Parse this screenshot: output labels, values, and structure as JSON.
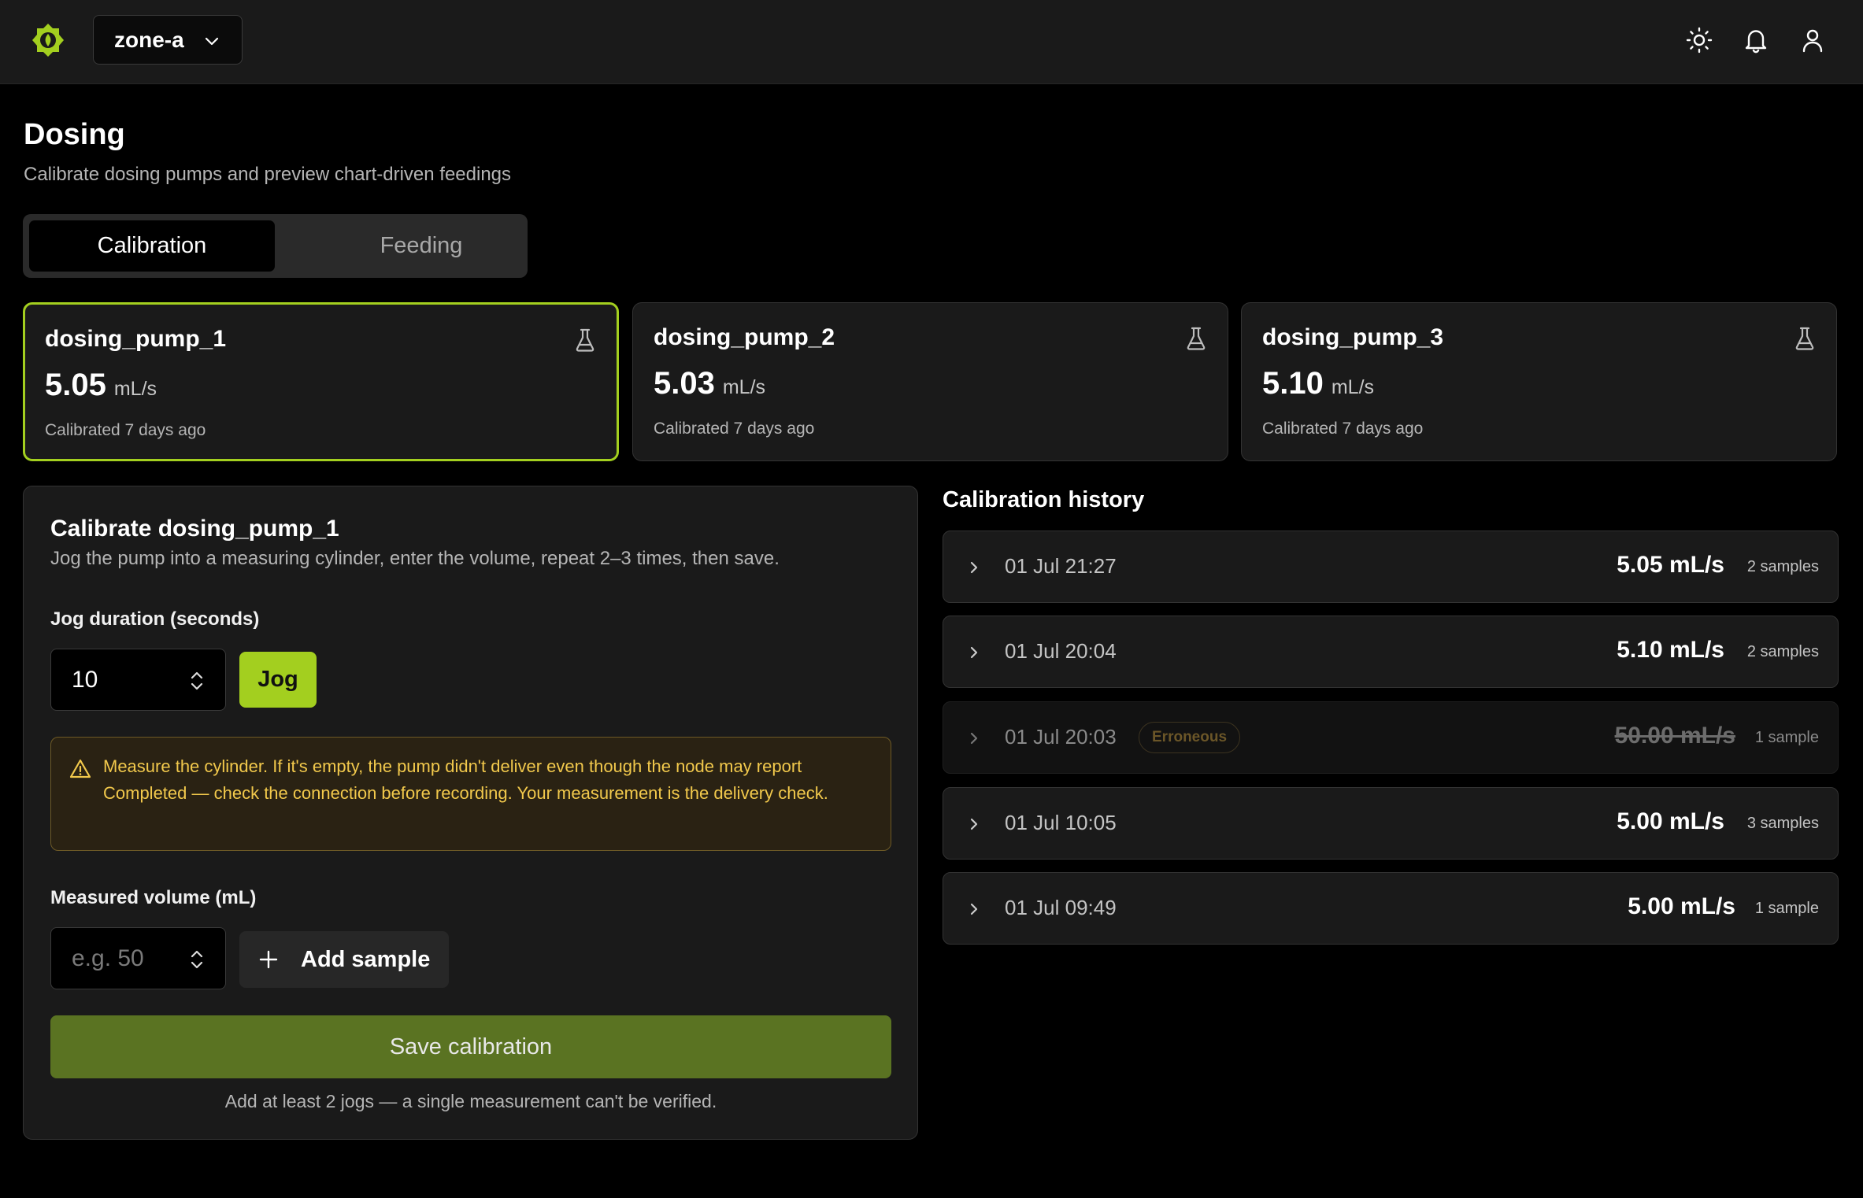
{
  "header": {
    "zone": "zone-a",
    "icons": [
      "sun-icon",
      "bell-icon",
      "user-icon"
    ]
  },
  "page": {
    "title": "Dosing",
    "subtitle": "Calibrate dosing pumps and preview chart-driven feedings"
  },
  "tabs": [
    {
      "label": "Calibration",
      "active": true
    },
    {
      "label": "Feeding",
      "active": false
    }
  ],
  "pumps": [
    {
      "name": "dosing_pump_1",
      "rate": "5.05",
      "unit": "mL/s",
      "calibrated": "Calibrated 7 days ago",
      "selected": true
    },
    {
      "name": "dosing_pump_2",
      "rate": "5.03",
      "unit": "mL/s",
      "calibrated": "Calibrated 7 days ago",
      "selected": false
    },
    {
      "name": "dosing_pump_3",
      "rate": "5.10",
      "unit": "mL/s",
      "calibrated": "Calibrated 7 days ago",
      "selected": false
    }
  ],
  "calibrate": {
    "title": "Calibrate dosing_pump_1",
    "description": "Jog the pump into a measuring cylinder, enter the volume, repeat 2–3 times, then save.",
    "jog_label": "Jog duration (seconds)",
    "jog_value": "10",
    "jog_button": "Jog",
    "warning": "Measure the cylinder. If it's empty, the pump didn't deliver even though the node may report Completed — check the connection before recording. Your measurement is the delivery check.",
    "volume_label": "Measured volume (mL)",
    "volume_placeholder": "e.g. 50",
    "add_sample": "Add sample",
    "save_button": "Save calibration",
    "save_note": "Add at least 2 jogs — a single measurement can't be verified."
  },
  "history": {
    "title": "Calibration history",
    "rows": [
      {
        "date": "01 Jul 21:27",
        "rate": "5.05 mL/s",
        "samples": "2 samples",
        "badge": "",
        "erroneous": false
      },
      {
        "date": "01 Jul 20:04",
        "rate": "5.10 mL/s",
        "samples": "2 samples",
        "badge": "",
        "erroneous": false
      },
      {
        "date": "01 Jul 20:03",
        "rate": "50.00 mL/s",
        "samples": "1 sample",
        "badge": "Erroneous",
        "erroneous": true
      },
      {
        "date": "01 Jul 10:05",
        "rate": "5.00 mL/s",
        "samples": "3 samples",
        "badge": "",
        "erroneous": false
      },
      {
        "date": "01 Jul 09:49",
        "rate": "5.00 mL/s",
        "samples": "1 sample",
        "badge": "",
        "erroneous": false
      }
    ]
  },
  "colors": {
    "accent": "#a3cf1f",
    "save_button": "#5a7322",
    "warning_text": "#f2c94c"
  }
}
